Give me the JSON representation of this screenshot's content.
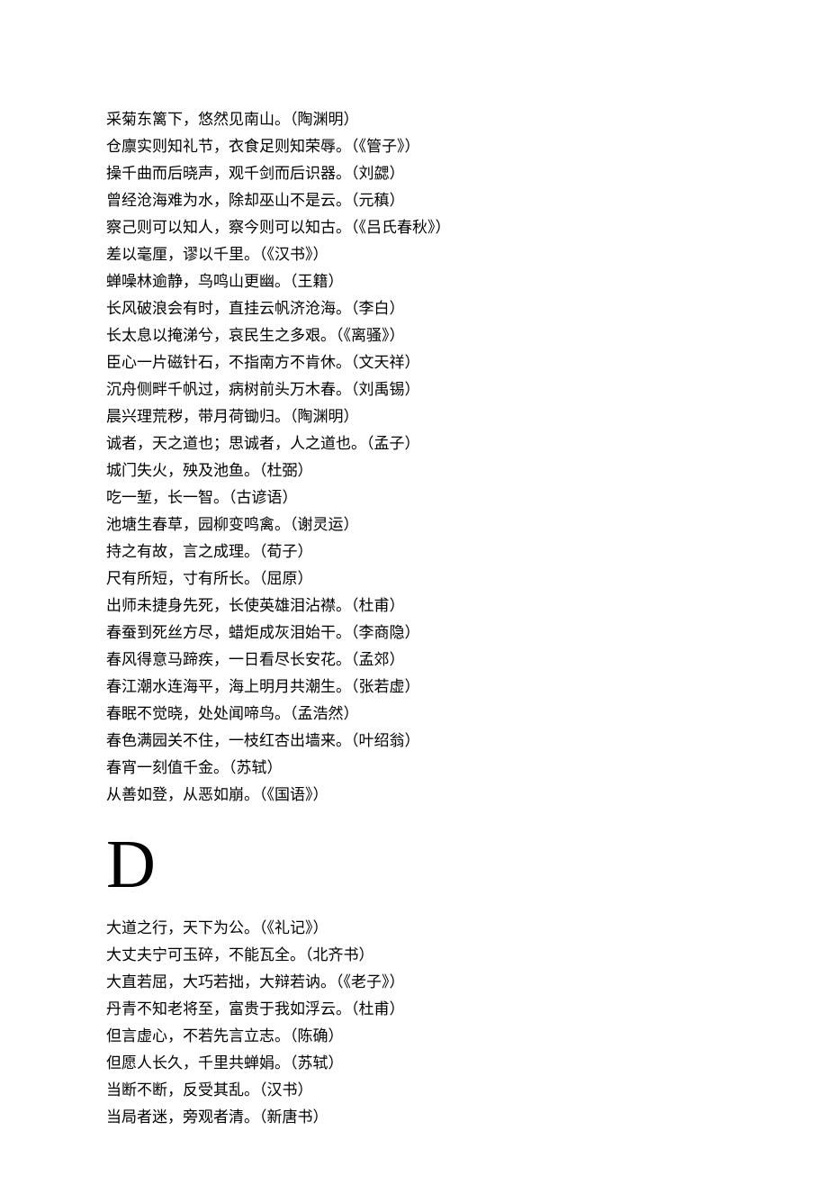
{
  "section_c": {
    "lines": [
      "采菊东篱下，悠然见南山。（陶渊明）",
      "仓廪实则知礼节，衣食足则知荣辱。（《管子》）",
      "操千曲而后晓声，观千剑而后识器。（刘勰）",
      "曾经沧海难为水，除却巫山不是云。（元稹）",
      "察己则可以知人，察今则可以知古。（《吕氏春秋》）",
      "差以毫厘，谬以千里。（《汉书》）",
      "蝉噪林逾静，鸟鸣山更幽。（王籍）",
      "长风破浪会有时，直挂云帆济沧海。（李白）",
      "长太息以掩涕兮，哀民生之多艰。（《离骚》）",
      "臣心一片磁针石，不指南方不肯休。（文天祥）",
      "沉舟侧畔千帆过，病树前头万木春。（刘禹锡）",
      "晨兴理荒秽，带月荷锄归。（陶渊明）",
      "诚者，天之道也；思诚者，人之道也。（孟子）",
      "城门失火，殃及池鱼。（杜弼）",
      "吃一堑，长一智。（古谚语）",
      "池塘生春草，园柳变鸣禽。（谢灵运）",
      "持之有故，言之成理。（荀子）",
      "尺有所短，寸有所长。（屈原）",
      "出师未捷身先死，长使英雄泪沾襟。（杜甫）",
      "春蚕到死丝方尽，蜡炬成灰泪始干。（李商隐）",
      "春风得意马蹄疾，一日看尽长安花。（孟郊）",
      "春江潮水连海平，海上明月共潮生。（张若虚）",
      "春眠不觉晓，处处闻啼鸟。（孟浩然）",
      "春色满园关不住，一枝红杏出墙来。（叶绍翁）",
      "春宵一刻值千金。（苏轼）",
      "从善如登，从恶如崩。（《国语》）"
    ]
  },
  "section_d": {
    "header": "D",
    "lines": [
      "大道之行，天下为公。（《礼记》）",
      "大丈夫宁可玉碎，不能瓦全。（北齐书）",
      "大直若屈，大巧若拙，大辩若讷。（《老子》）",
      "丹青不知老将至，富贵于我如浮云。（杜甫）",
      "但言虚心，不若先言立志。（陈确）",
      "但愿人长久，千里共蝉娟。（苏轼）",
      "当断不断，反受其乱。（汉书）",
      "当局者迷，旁观者清。（新唐书）"
    ]
  }
}
